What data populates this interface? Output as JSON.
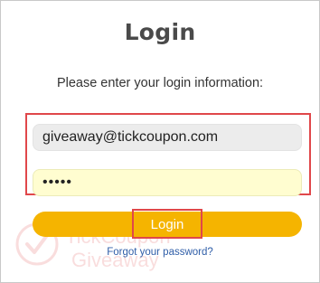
{
  "login": {
    "title": "Login",
    "instructions": "Please enter your login information:",
    "email_value": "giveaway@tickcoupon.com",
    "password_value": "•••••",
    "submit_label": "Login",
    "forgot_link": "Forgot your password?"
  },
  "watermark": {
    "line1": "TickCoupon",
    "line2": "Giveaway"
  },
  "colors": {
    "button": "#f5b400",
    "highlight": "#e0474a",
    "link": "#2f5ea8"
  }
}
